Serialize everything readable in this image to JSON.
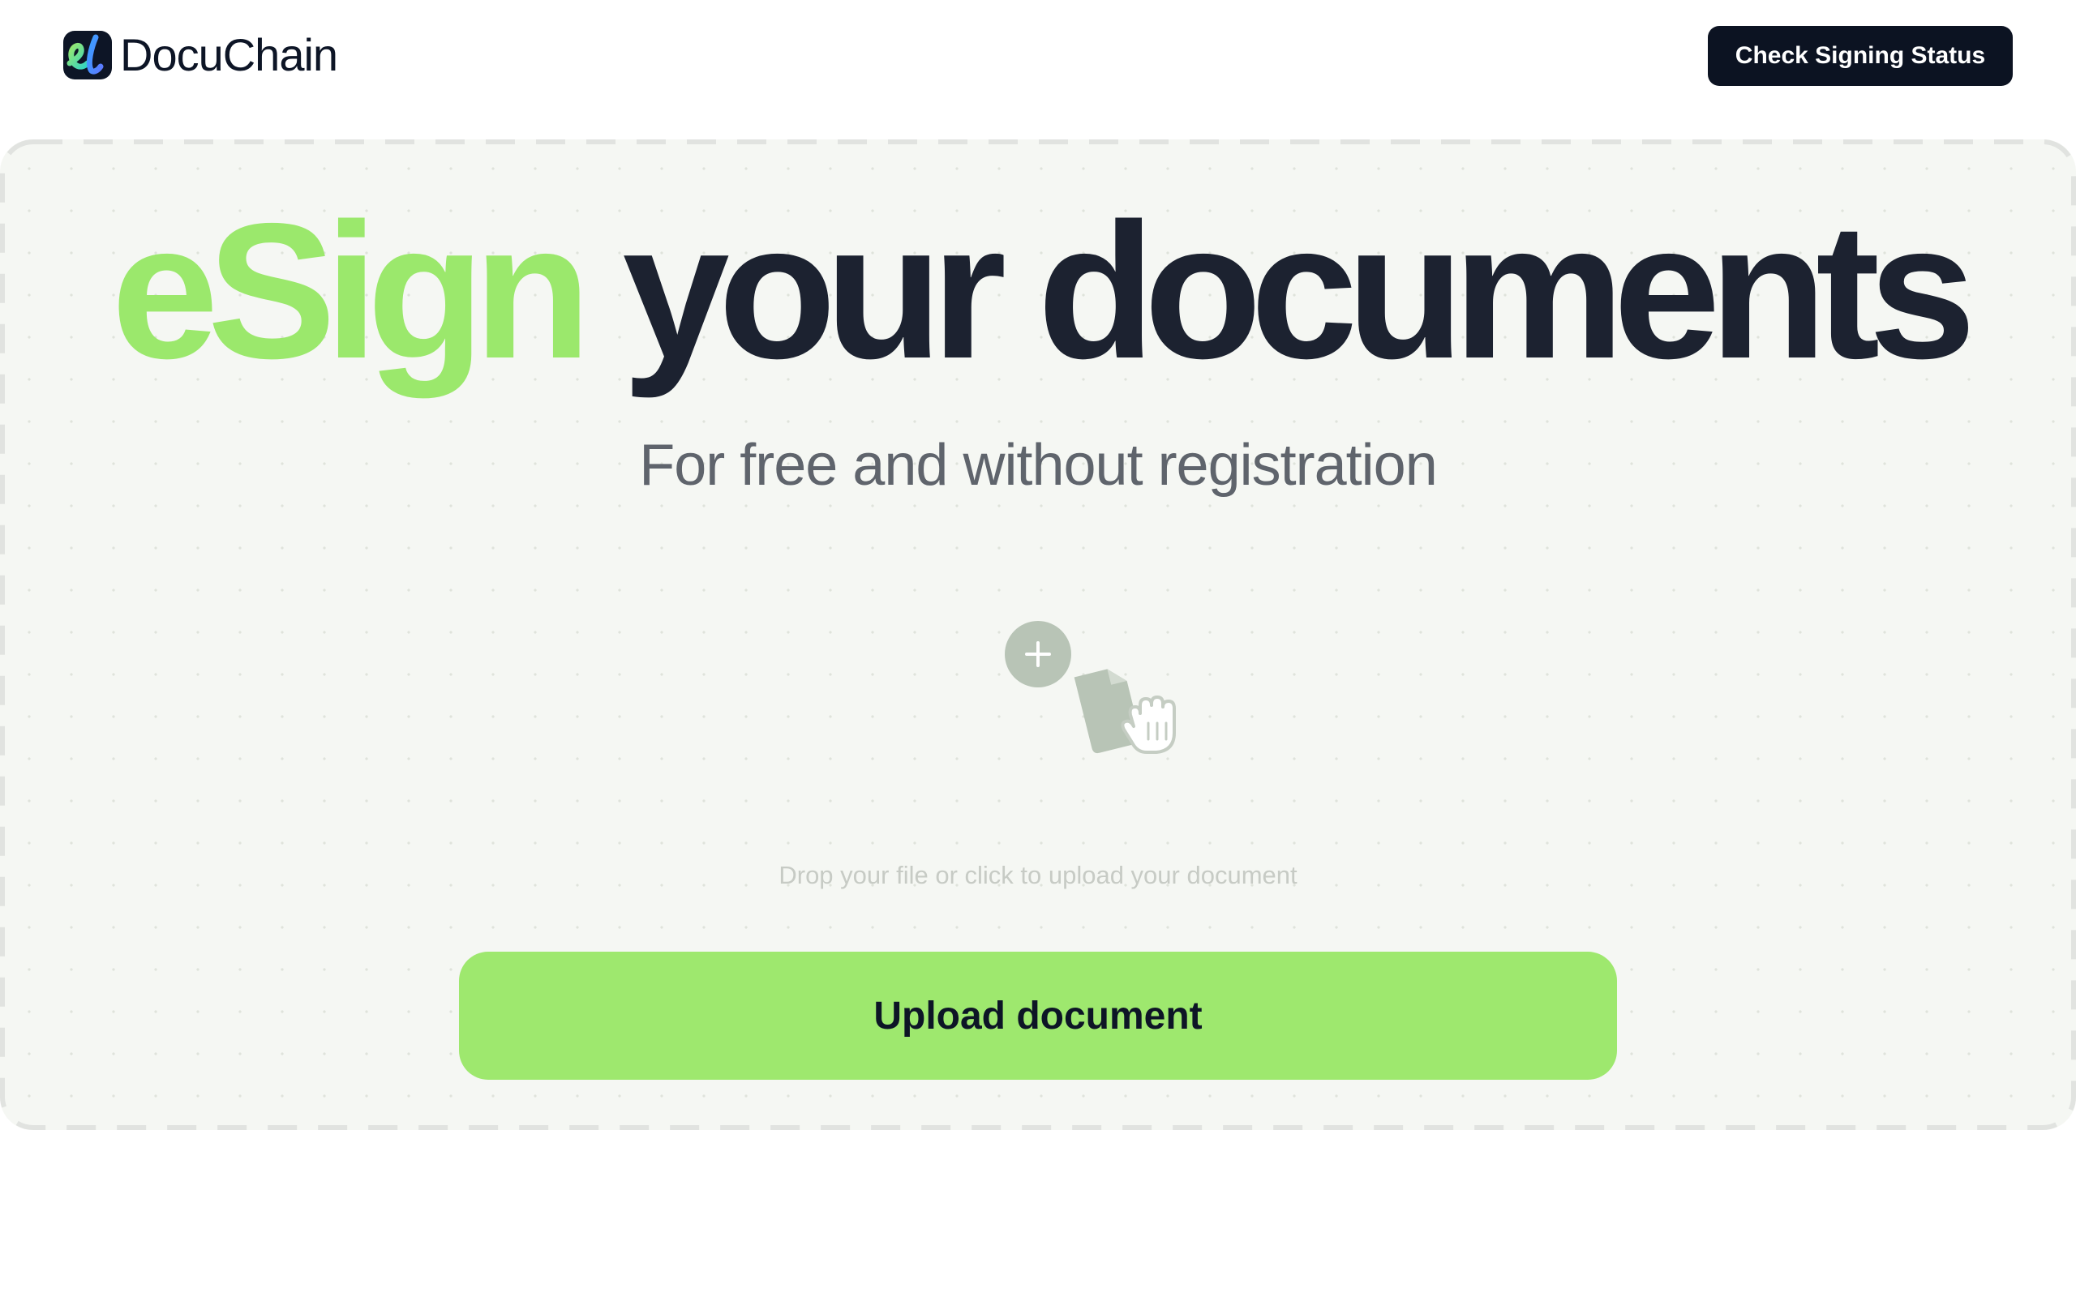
{
  "brand": {
    "name": "DocuChain",
    "logo_icon": "el-monogram-icon"
  },
  "header": {
    "status_button": "Check Signing Status"
  },
  "hero": {
    "title_highlight": "eSign",
    "title_rest": "your documents",
    "subtitle": "For free and without registration"
  },
  "dropzone": {
    "hint": "Drop your file or click to upload your document",
    "upload_button": "Upload document",
    "icons": [
      "plus-icon",
      "document-icon",
      "hand-cursor-icon"
    ]
  },
  "colors": {
    "accent_green": "#9ee86e",
    "dark": "#0c1322",
    "dropzone_bg": "#f5f7f3"
  }
}
